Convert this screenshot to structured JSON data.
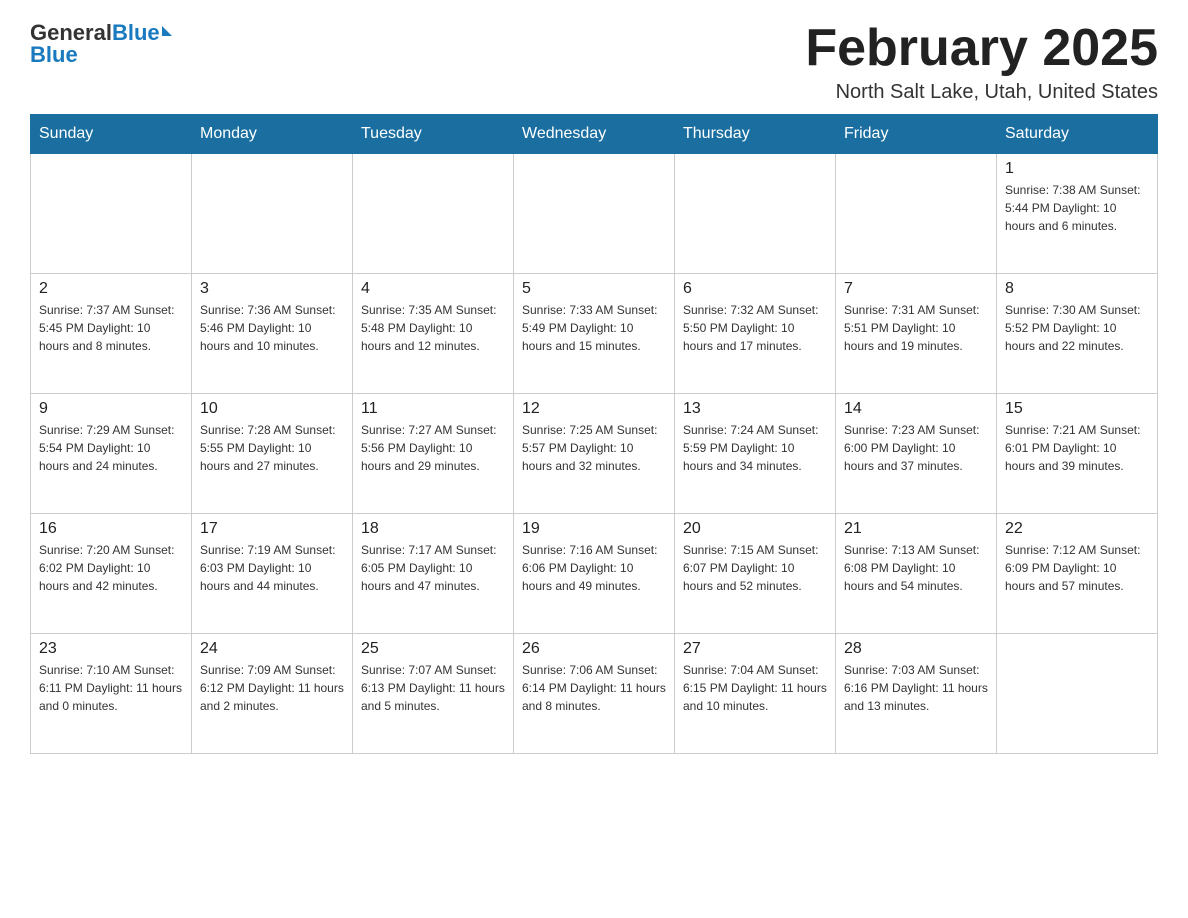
{
  "header": {
    "logo_general": "General",
    "logo_blue": "Blue",
    "title": "February 2025",
    "subtitle": "North Salt Lake, Utah, United States"
  },
  "days_of_week": [
    "Sunday",
    "Monday",
    "Tuesday",
    "Wednesday",
    "Thursday",
    "Friday",
    "Saturday"
  ],
  "weeks": [
    [
      {
        "day": "",
        "info": ""
      },
      {
        "day": "",
        "info": ""
      },
      {
        "day": "",
        "info": ""
      },
      {
        "day": "",
        "info": ""
      },
      {
        "day": "",
        "info": ""
      },
      {
        "day": "",
        "info": ""
      },
      {
        "day": "1",
        "info": "Sunrise: 7:38 AM\nSunset: 5:44 PM\nDaylight: 10 hours and 6 minutes."
      }
    ],
    [
      {
        "day": "2",
        "info": "Sunrise: 7:37 AM\nSunset: 5:45 PM\nDaylight: 10 hours and 8 minutes."
      },
      {
        "day": "3",
        "info": "Sunrise: 7:36 AM\nSunset: 5:46 PM\nDaylight: 10 hours and 10 minutes."
      },
      {
        "day": "4",
        "info": "Sunrise: 7:35 AM\nSunset: 5:48 PM\nDaylight: 10 hours and 12 minutes."
      },
      {
        "day": "5",
        "info": "Sunrise: 7:33 AM\nSunset: 5:49 PM\nDaylight: 10 hours and 15 minutes."
      },
      {
        "day": "6",
        "info": "Sunrise: 7:32 AM\nSunset: 5:50 PM\nDaylight: 10 hours and 17 minutes."
      },
      {
        "day": "7",
        "info": "Sunrise: 7:31 AM\nSunset: 5:51 PM\nDaylight: 10 hours and 19 minutes."
      },
      {
        "day": "8",
        "info": "Sunrise: 7:30 AM\nSunset: 5:52 PM\nDaylight: 10 hours and 22 minutes."
      }
    ],
    [
      {
        "day": "9",
        "info": "Sunrise: 7:29 AM\nSunset: 5:54 PM\nDaylight: 10 hours and 24 minutes."
      },
      {
        "day": "10",
        "info": "Sunrise: 7:28 AM\nSunset: 5:55 PM\nDaylight: 10 hours and 27 minutes."
      },
      {
        "day": "11",
        "info": "Sunrise: 7:27 AM\nSunset: 5:56 PM\nDaylight: 10 hours and 29 minutes."
      },
      {
        "day": "12",
        "info": "Sunrise: 7:25 AM\nSunset: 5:57 PM\nDaylight: 10 hours and 32 minutes."
      },
      {
        "day": "13",
        "info": "Sunrise: 7:24 AM\nSunset: 5:59 PM\nDaylight: 10 hours and 34 minutes."
      },
      {
        "day": "14",
        "info": "Sunrise: 7:23 AM\nSunset: 6:00 PM\nDaylight: 10 hours and 37 minutes."
      },
      {
        "day": "15",
        "info": "Sunrise: 7:21 AM\nSunset: 6:01 PM\nDaylight: 10 hours and 39 minutes."
      }
    ],
    [
      {
        "day": "16",
        "info": "Sunrise: 7:20 AM\nSunset: 6:02 PM\nDaylight: 10 hours and 42 minutes."
      },
      {
        "day": "17",
        "info": "Sunrise: 7:19 AM\nSunset: 6:03 PM\nDaylight: 10 hours and 44 minutes."
      },
      {
        "day": "18",
        "info": "Sunrise: 7:17 AM\nSunset: 6:05 PM\nDaylight: 10 hours and 47 minutes."
      },
      {
        "day": "19",
        "info": "Sunrise: 7:16 AM\nSunset: 6:06 PM\nDaylight: 10 hours and 49 minutes."
      },
      {
        "day": "20",
        "info": "Sunrise: 7:15 AM\nSunset: 6:07 PM\nDaylight: 10 hours and 52 minutes."
      },
      {
        "day": "21",
        "info": "Sunrise: 7:13 AM\nSunset: 6:08 PM\nDaylight: 10 hours and 54 minutes."
      },
      {
        "day": "22",
        "info": "Sunrise: 7:12 AM\nSunset: 6:09 PM\nDaylight: 10 hours and 57 minutes."
      }
    ],
    [
      {
        "day": "23",
        "info": "Sunrise: 7:10 AM\nSunset: 6:11 PM\nDaylight: 11 hours and 0 minutes."
      },
      {
        "day": "24",
        "info": "Sunrise: 7:09 AM\nSunset: 6:12 PM\nDaylight: 11 hours and 2 minutes."
      },
      {
        "day": "25",
        "info": "Sunrise: 7:07 AM\nSunset: 6:13 PM\nDaylight: 11 hours and 5 minutes."
      },
      {
        "day": "26",
        "info": "Sunrise: 7:06 AM\nSunset: 6:14 PM\nDaylight: 11 hours and 8 minutes."
      },
      {
        "day": "27",
        "info": "Sunrise: 7:04 AM\nSunset: 6:15 PM\nDaylight: 11 hours and 10 minutes."
      },
      {
        "day": "28",
        "info": "Sunrise: 7:03 AM\nSunset: 6:16 PM\nDaylight: 11 hours and 13 minutes."
      },
      {
        "day": "",
        "info": ""
      }
    ]
  ]
}
